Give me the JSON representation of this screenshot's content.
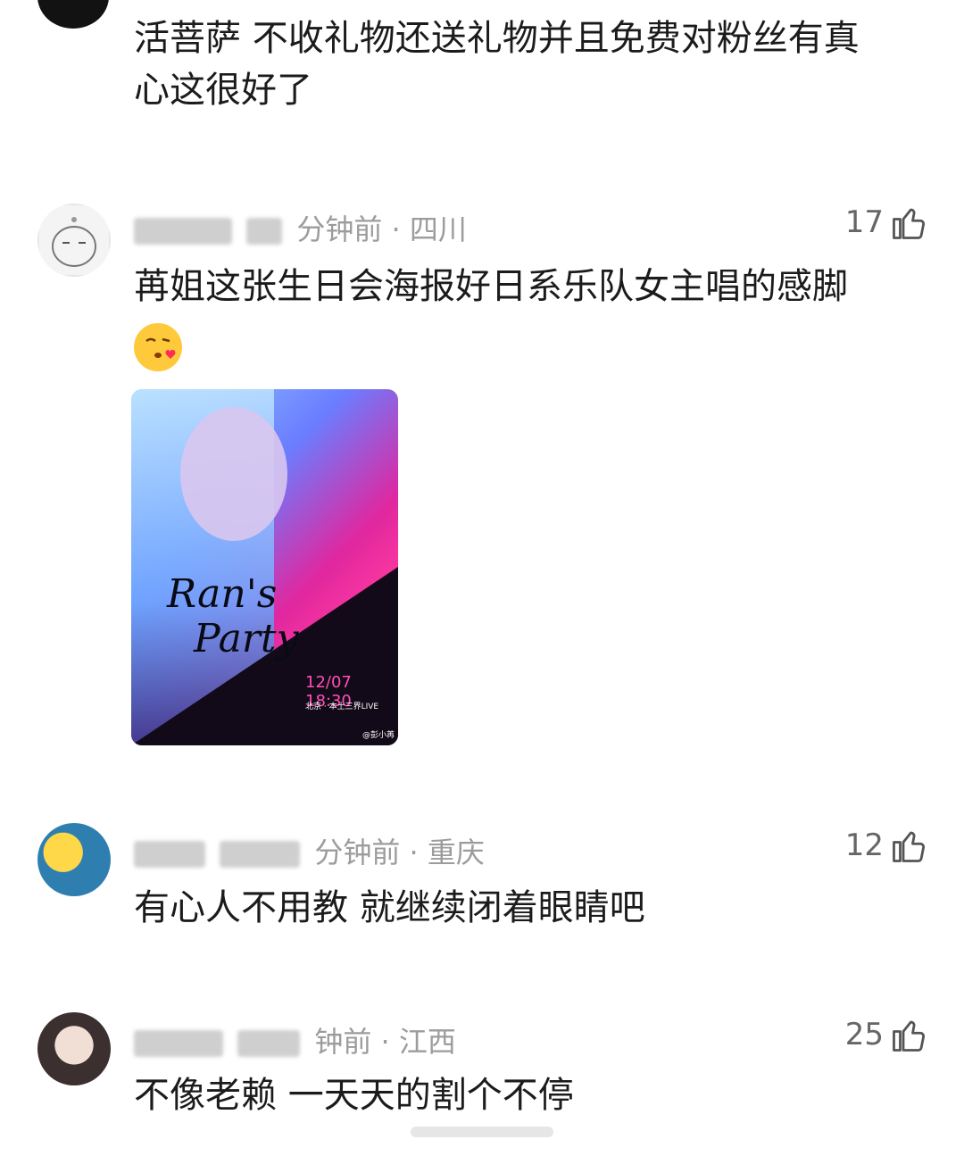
{
  "comments": [
    {
      "text_line1": "活菩萨 不收礼物还送礼物并且免费对粉丝有真",
      "text_line2": "心这很好了"
    },
    {
      "time_location": "分钟前 · 四川",
      "likes": "17",
      "text": "苒姐这张生日会海报好日系乐队女主唱的感脚",
      "emoji": "😘",
      "image": {
        "title_line1": "Ran's",
        "title_line2": "Party",
        "date": "12/07 18:30",
        "location": "北京 · 本土三界LIVE",
        "watermark": "@彭小苒"
      }
    },
    {
      "time_location": "分钟前 · 重庆",
      "likes": "12",
      "text": "有心人不用教 就继续闭着眼睛吧"
    },
    {
      "time_location": "钟前 · 江西",
      "likes": "25",
      "text": "不像老赖 一天天的割个不停"
    }
  ]
}
